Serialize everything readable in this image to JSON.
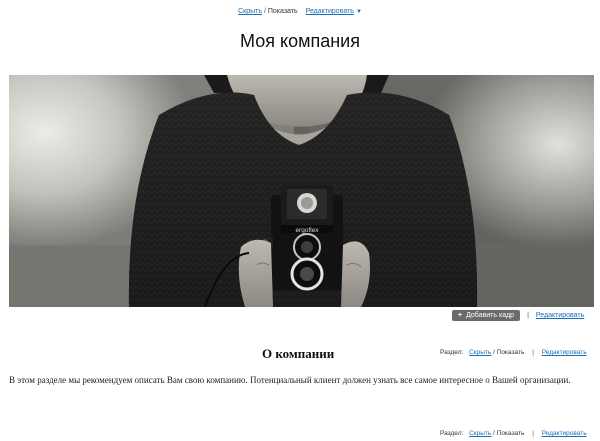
{
  "visibility": {
    "hide_label": "Скрыть",
    "separator": "/",
    "show_label": "Показать",
    "edit_label": "Редактировать"
  },
  "site": {
    "title": "Моя компания"
  },
  "banner": {
    "camera_brand": "ergoflex",
    "add_frame_label": "Добавить кадр",
    "edit_label": "Редактировать"
  },
  "about": {
    "title": "О компании",
    "text": "В этом разделе мы рекомендуем описать Вам свою компанию. Потенциальный клиент должен узнать все самое интересное о Вашей организации."
  },
  "section_controls": {
    "section_label": "Раздел:",
    "hide_label": "Скрыть",
    "separator": "/",
    "show_label": "Показать",
    "bar": "|",
    "edit_label": "Редактировать"
  },
  "colors": {
    "link": "#1a6fb5",
    "button_bg": "#6b6b6b"
  }
}
